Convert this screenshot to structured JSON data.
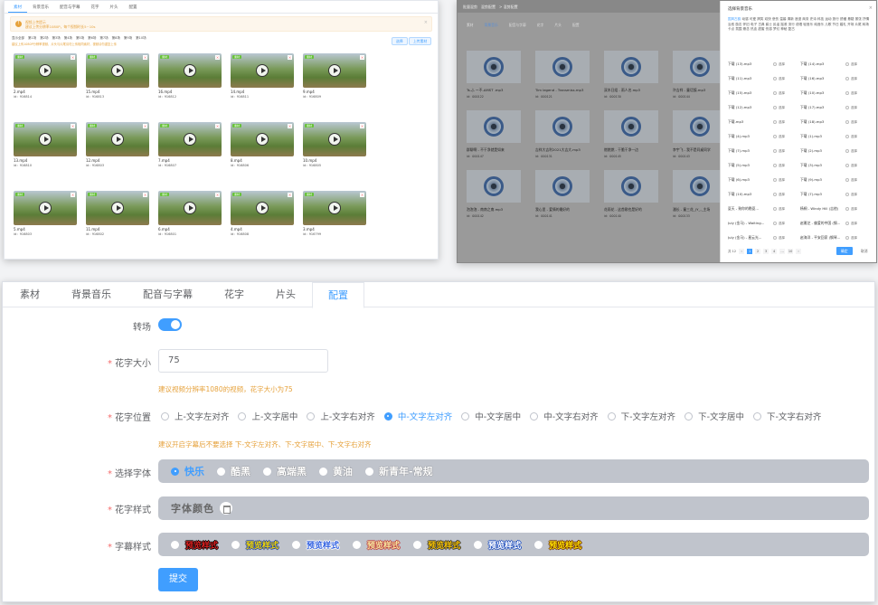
{
  "material_panel": {
    "tabs": [
      {
        "label": "素材"
      },
      {
        "label": "背景音乐"
      },
      {
        "label": "配音与字幕"
      },
      {
        "label": "花字"
      },
      {
        "label": "片头"
      },
      {
        "label": "配置"
      }
    ],
    "alert": {
      "line1": "视频上传提示",
      "line2": "建议上传分辨率1080P，每个视频时长5~10s"
    },
    "filters": [
      "显示全部",
      "第1场",
      "第2场",
      "第3场",
      "第4场",
      "第5场",
      "第6场",
      "第7场",
      "第8场",
      "第9场",
      "第10场"
    ],
    "hint": "建议上传1080P分辨率视频，片头与片尾请勿上传相同素材，视频请勿重复上传",
    "btn_select": "选择",
    "btn_upload": "上传素材",
    "videos": [
      {
        "name": "2.mp4",
        "id": "id：916814"
      },
      {
        "name": "15.mp4",
        "id": "id：916813"
      },
      {
        "name": "16.mp4",
        "id": "id：916812"
      },
      {
        "name": "14.mp4",
        "id": "id：916811"
      },
      {
        "name": "9.mp4",
        "id": "id：916809"
      },
      {
        "name": "13.mp4",
        "id": "id：916810"
      },
      {
        "name": "12.mp4",
        "id": "id：916803"
      },
      {
        "name": "7.mp4",
        "id": "id：916807"
      },
      {
        "name": "8.mp4",
        "id": "id：916806"
      },
      {
        "name": "10.mp4",
        "id": "id：916805"
      },
      {
        "name": "5.mp4",
        "id": "id：916803"
      },
      {
        "name": "11.mp4",
        "id": "id：916802"
      },
      {
        "name": "6.mp4",
        "id": "id：916801"
      },
      {
        "name": "4.mp4",
        "id": "id：916808"
      },
      {
        "name": "3.mp4",
        "id": "id：916799"
      }
    ],
    "tag": "素材"
  },
  "music_panel": {
    "top": "批量混剪　混剪配置　> 混剪配置",
    "tabs": [
      {
        "label": "素材"
      },
      {
        "label": "背景音乐"
      },
      {
        "label": "配音与字幕"
      },
      {
        "label": "花字"
      },
      {
        "label": "片头"
      },
      {
        "label": "配置"
      }
    ],
    "tracks": [
      {
        "name": "Ts.ふ ー不-AMST .mp3",
        "id": "id：000122"
      },
      {
        "name": "Tim legend - Transmiss.mp3",
        "id": "id：000121"
      },
      {
        "name": "双木日组 - 雨人名.mp3",
        "id": "id：000130"
      },
      {
        "name": "许吉祥 - 童话镇.mp3",
        "id": "id：000144"
      },
      {
        "name": "群聊啊 - 不干净就是如来",
        "id": "id：000147"
      },
      {
        "name": "吉祥大吉利2021大吉大.mp3",
        "id": "id：000131"
      },
      {
        "name": "燃燃燃 - 干脆干净一边",
        "id": "id：000145"
      },
      {
        "name": "李宇飞 - 我不是同桌同学",
        "id": "id：000143"
      },
      {
        "name": "泡泡泡 - 南南之南.mp3",
        "id": "id：000142"
      },
      {
        "name": "我心里 - 爱情的最好的",
        "id": "id：000141"
      },
      {
        "name": "花雨花 - 这首歌也是好的",
        "id": "id：000140"
      },
      {
        "name": "潘长 - 童三花_(Y_-_主场",
        "id": "id：000133"
      }
    ],
    "drawer": {
      "title": "选择背景音乐",
      "categories_a": [
        "国风古韵",
        "动感",
        "可爱",
        "搞笑",
        "欢快",
        "悲伤",
        "温馨",
        "清新",
        "浪漫",
        "商务",
        "史诗",
        "科技",
        "运动",
        "旅行",
        "舒缓"
      ],
      "categories_b": "悬疑 紧张 抒情 治愈 励志 怀旧 电子 古典 爵士 民谣 摇滚 流行 说唱 轻音乐 纯音乐 儿歌 节日 婚礼 开场 片尾 转场 卡点 氛围 悬念 热血 甜蜜 伤感 梦幻 神秘 复古",
      "items": [
        {
          "name": "下载 (13).mp3",
          "sel": "选择"
        },
        {
          "name": "下载 (14).mp3",
          "sel": "选择"
        },
        {
          "name": "下载 (11).mp3",
          "sel": "选择"
        },
        {
          "name": "下载 (16).mp3",
          "sel": "选择"
        },
        {
          "name": "下载 (15).mp3",
          "sel": "选择"
        },
        {
          "name": "下载 (10).mp3",
          "sel": "选择"
        },
        {
          "name": "下载 (12).mp3",
          "sel": "选择"
        },
        {
          "name": "下载 (17).mp3",
          "sel": "选择"
        },
        {
          "name": "下载.mp3",
          "sel": "选择"
        },
        {
          "name": "下载 (18).mp3",
          "sel": "选择"
        },
        {
          "name": "下载 (4).mp3",
          "sel": "选择"
        },
        {
          "name": "下载 (1).mp3",
          "sel": "选择"
        },
        {
          "name": "下载 (7).mp3",
          "sel": "选择"
        },
        {
          "name": "下载 (2).mp3",
          "sel": "选择"
        },
        {
          "name": "下载 (5).mp3",
          "sel": "选择"
        },
        {
          "name": "下载 (3).mp3",
          "sel": "选择"
        },
        {
          "name": "下载 (6).mp3",
          "sel": "选择"
        },
        {
          "name": "下载 (9).mp3",
          "sel": "选择"
        },
        {
          "name": "下载 (10).mp3",
          "sel": "选择"
        },
        {
          "name": "下载 (7).mp3",
          "sel": "选择"
        },
        {
          "name": "夏天 - 致你的晚夏...",
          "sel": "选择"
        },
        {
          "name": "杨桐 - Windy Hill (吉他)",
          "sel": "选择"
        },
        {
          "name": "July (金马) - Waiting...",
          "sel": "选择"
        },
        {
          "name": "赵雅芝 - 偏爱的中国 (钢...",
          "sel": "选择"
        },
        {
          "name": "July (金马) - 星云光...",
          "sel": "选择"
        },
        {
          "name": "赵海洋 - 平安回家 (钢琴...",
          "sel": "选择"
        }
      ],
      "pager": {
        "total": "共 12",
        "pages": [
          "1",
          "2",
          "3",
          "4",
          "…",
          "10"
        ]
      },
      "btn_ok": "确定",
      "btn_cancel": "取消"
    }
  },
  "config_panel": {
    "tabs": [
      {
        "label": "素材"
      },
      {
        "label": "背景音乐"
      },
      {
        "label": "配音与字幕"
      },
      {
        "label": "花字"
      },
      {
        "label": "片头"
      },
      {
        "label": "配置"
      }
    ],
    "transition_label": "转场",
    "font_size_label": "花字大小",
    "font_size_value": "75",
    "font_size_tip": "建议视频分辨率1080的视频，花字大小为75",
    "position_label": "花字位置",
    "positions": [
      "上-文字左对齐",
      "上-文字居中",
      "上-文字右对齐",
      "中-文字左对齐",
      "中-文字居中",
      "中-文字右对齐",
      "下-文字左对齐",
      "下-文字居中",
      "下-文字右对齐"
    ],
    "position_selected": 3,
    "position_tip": "建议开启字幕后不要选择 下-文字左对齐、下-文字居中、下-文字右对齐",
    "font_label": "选择字体",
    "fonts": [
      "快乐",
      "酷黑",
      "高端黑",
      "黄油",
      "新青年-常规"
    ],
    "style_label": "花字样式",
    "style_value": "字体颜色",
    "subtitle_label": "字幕样式",
    "subtitle_styles": [
      {
        "text": "预览样式",
        "color": "#e02020",
        "stroke": "#000"
      },
      {
        "text": "预览样式",
        "color": "#f5d800",
        "stroke": "#2040a0"
      },
      {
        "text": "预览样式",
        "color": "#3060e0",
        "stroke": "#fff"
      },
      {
        "text": "预览样式",
        "color": "#f5e6a0",
        "stroke": "#c04040"
      },
      {
        "text": "预览样式",
        "color": "#f5c000",
        "stroke": "#333"
      },
      {
        "text": "预览样式",
        "color": "#ffffff",
        "stroke": "#2050c0"
      },
      {
        "text": "预览样式",
        "color": "#ffe000",
        "stroke": "#703000"
      }
    ],
    "submit": "提交"
  }
}
